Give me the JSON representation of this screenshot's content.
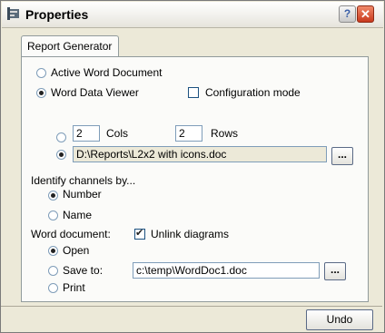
{
  "window": {
    "title": "Properties",
    "help_label": "?",
    "close_label": "✕"
  },
  "tabs": [
    {
      "label": "Report Generator",
      "active": true
    }
  ],
  "source": {
    "active_word_document": {
      "label": "Active Word Document",
      "selected": false
    },
    "word_data_viewer": {
      "label": "Word Data Viewer",
      "selected": true
    },
    "configuration_mode": {
      "label": "Configuration mode",
      "checked": false
    }
  },
  "layout_option": {
    "grid": {
      "selected": false,
      "cols_value": "2",
      "cols_label": "Cols",
      "rows_value": "2",
      "rows_label": "Rows"
    },
    "file": {
      "selected": true,
      "path": "D:\\Reports\\L2x2 with icons.doc",
      "browse_label": "..."
    }
  },
  "identify_channels": {
    "heading": "Identify channels by...",
    "number": {
      "label": "Number",
      "selected": true
    },
    "name": {
      "label": "Name",
      "selected": false
    }
  },
  "word_document": {
    "label": "Word document:",
    "unlink_diagrams": {
      "label": "Unlink diagrams",
      "checked": true
    },
    "open": {
      "label": "Open",
      "selected": true
    },
    "save_to": {
      "label": "Save to:",
      "selected": false,
      "path": "c:\\temp\\WordDoc1.doc",
      "browse_label": "..."
    },
    "print": {
      "label": "Print",
      "selected": false
    }
  },
  "footer": {
    "undo_label": "Undo"
  }
}
